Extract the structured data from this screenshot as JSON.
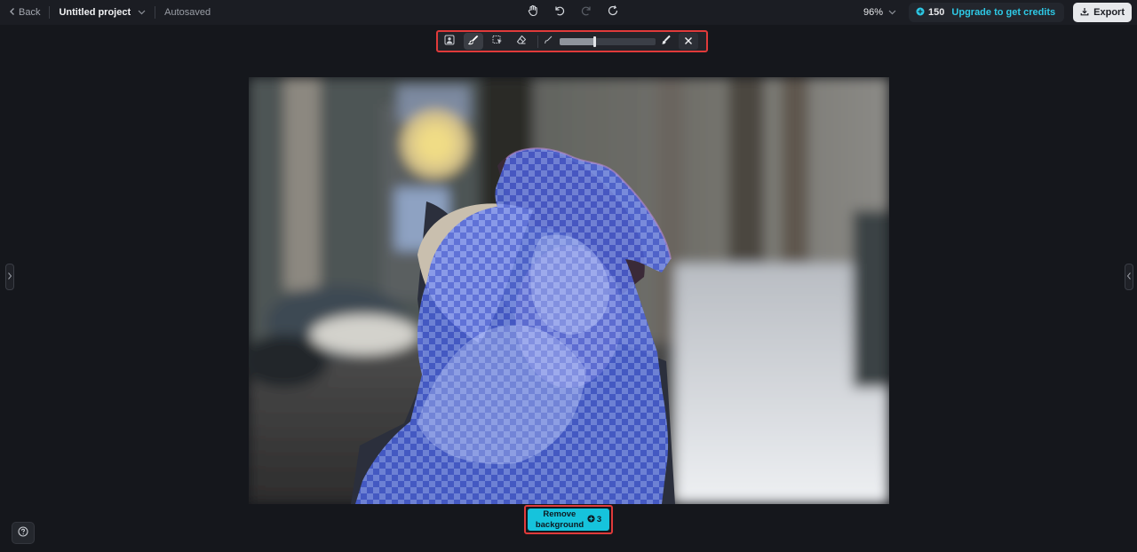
{
  "topbar": {
    "back_label": "Back",
    "project_name": "Untitled project",
    "autosave_status": "Autosaved",
    "zoom_level": "96%",
    "credits": "150",
    "upgrade_label": "Upgrade to get credits",
    "export_label": "Export"
  },
  "toolbar": {
    "tools": [
      "person-select-icon",
      "brush-icon",
      "smart-select-icon",
      "eraser-icon"
    ],
    "active_tool": "brush-icon",
    "brush_size_fraction": 0.36
  },
  "action": {
    "remove_bg_label_line1": "Remove",
    "remove_bg_label_line2": "background",
    "remove_bg_cost": "3"
  },
  "colors": {
    "accent": "#16c3dc",
    "highlight": "#e03a3a",
    "mask": "#5a78ff"
  }
}
